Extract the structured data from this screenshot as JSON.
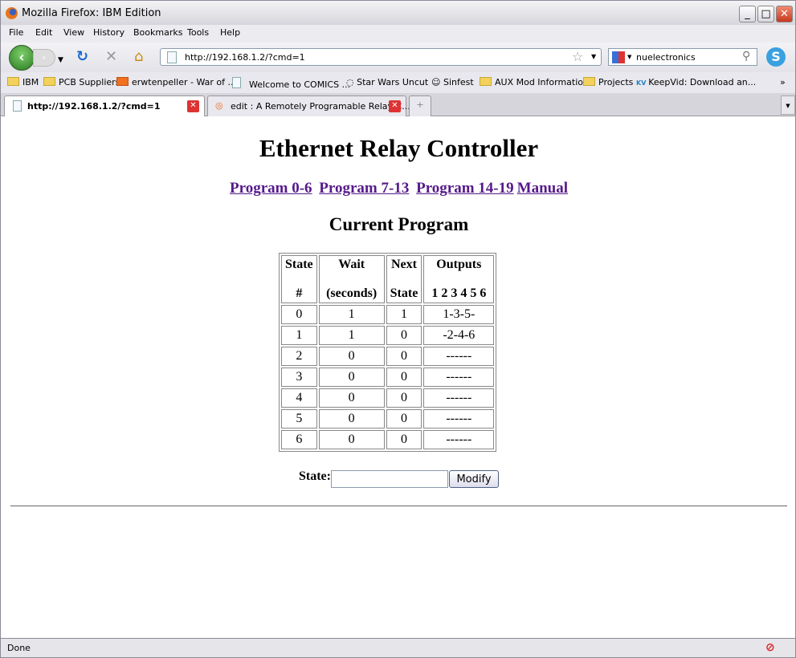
{
  "window": {
    "title": "Mozilla Firefox: IBM Edition"
  },
  "menu": [
    "File",
    "Edit",
    "View",
    "History",
    "Bookmarks",
    "Tools",
    "Help"
  ],
  "nav": {
    "url": "http://192.168.1.2/?cmd=1",
    "search_value": "nuelectronics"
  },
  "bookmarks": [
    {
      "label": "IBM",
      "icon": "folder"
    },
    {
      "label": "PCB Suppliers",
      "icon": "folder"
    },
    {
      "label": "erwtenpeller - War of ...",
      "icon": "cloud"
    },
    {
      "label": "Welcome to COMICS ...",
      "icon": "page"
    },
    {
      "label": "Star Wars Uncut",
      "icon": "star-wars"
    },
    {
      "label": "Sinfest",
      "icon": "face"
    },
    {
      "label": "AUX Mod Information",
      "icon": "folder"
    },
    {
      "label": "Projects",
      "icon": "folder"
    },
    {
      "label": "KeepVid: Download an...",
      "icon": "keepvid"
    }
  ],
  "tabs": [
    {
      "label": "http://192.168.1.2/?cmd=1",
      "active": true
    },
    {
      "label": "edit : A Remotely Programable Relay C...",
      "active": false
    }
  ],
  "page": {
    "title": "Ethernet Relay Controller",
    "links": [
      "Program 0-6",
      "Program 7-13",
      "Program 14-19",
      "Manual"
    ],
    "subtitle": "Current Program",
    "headers": [
      [
        "State",
        "#"
      ],
      [
        "Wait",
        "(seconds)"
      ],
      [
        "Next",
        "State"
      ],
      [
        "Outputs",
        "1 2 3 4 5 6"
      ]
    ],
    "rows": [
      [
        "0",
        "1",
        "1",
        "1-3-5-"
      ],
      [
        "1",
        "1",
        "0",
        "-2-4-6"
      ],
      [
        "2",
        "0",
        "0",
        "------"
      ],
      [
        "3",
        "0",
        "0",
        "------"
      ],
      [
        "4",
        "0",
        "0",
        "------"
      ],
      [
        "5",
        "0",
        "0",
        "------"
      ],
      [
        "6",
        "0",
        "0",
        "------"
      ]
    ],
    "state_label": "State:",
    "state_value": "",
    "modify_label": "Modify"
  },
  "status": {
    "text": "Done"
  }
}
